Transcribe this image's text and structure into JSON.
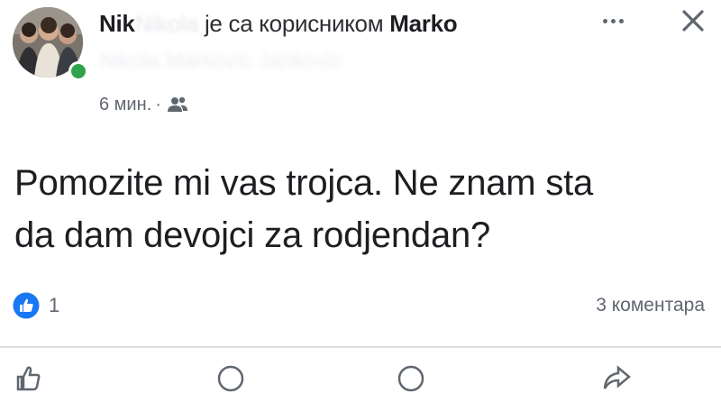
{
  "post": {
    "author": "Nik",
    "author_hidden": "Nikola",
    "with_text": "је са корисником",
    "tagged_user": "Marko",
    "hidden_subtitle": "Nikola Markovic Jankovic",
    "time": "6 мин.",
    "audience_icon": "friends-icon",
    "body": [
      "Pomozite mi vas trojca. Ne znam sta",
      "da dam devojci za rodjendan?"
    ],
    "reaction_icon": "like-icon",
    "reaction_count": "1",
    "comments": "3 коментара"
  },
  "icons": {
    "more": "more-options-icon",
    "close": "close-icon",
    "like_action": "thumbs-up-icon",
    "comment_action": "comment-icon",
    "share_action": "share-icon"
  },
  "colors": {
    "like_blue": "#1877f2",
    "online_green": "#31a24c",
    "secondary_text": "#606770",
    "divider": "#dadde1"
  }
}
